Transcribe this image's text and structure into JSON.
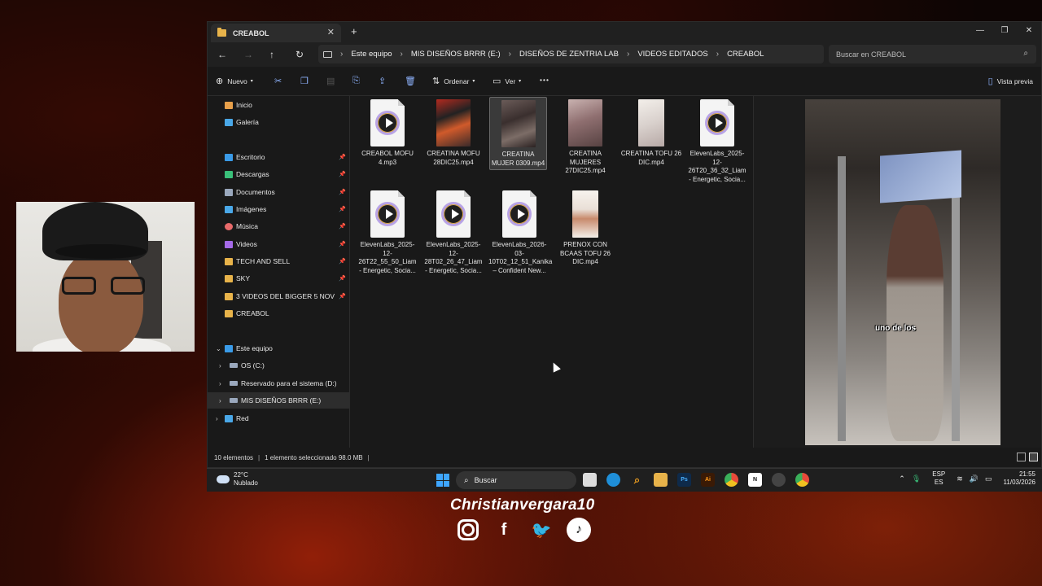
{
  "explorer": {
    "tab_title": "CREABOL",
    "tab_close": "✕",
    "new_tab": "+",
    "window_controls": [
      "—",
      "❐",
      "✕"
    ],
    "breadcrumb": [
      "Este equipo",
      "MIS DISEÑOS BRRR (E:)",
      "DISEÑOS DE ZENTRIA LAB",
      "VIDEOS EDITADOS",
      "CREABOL"
    ],
    "breadcrumb_separator": "›",
    "search_placeholder": "Buscar en CREABOL",
    "toolbar": {
      "new_label": "Nuevo",
      "sort_label": "Ordenar",
      "view_label": "Ver",
      "more_label": "•••",
      "preview_label": "Vista previa"
    },
    "sidebar": {
      "items": [
        {
          "label": "Inicio",
          "icon": "home-icon",
          "color": "#e8a04a"
        },
        {
          "label": "Galería",
          "icon": "gallery-icon",
          "color": "#4aa8e8"
        },
        {
          "label": "Escritorio",
          "icon": "desktop-icon",
          "color": "#3a9be8",
          "pinned": true
        },
        {
          "label": "Descargas",
          "icon": "download-icon",
          "color": "#3ac07a",
          "pinned": true
        },
        {
          "label": "Documentos",
          "icon": "documents-icon",
          "color": "#9aa8bd",
          "pinned": true
        },
        {
          "label": "Imágenes",
          "icon": "pictures-icon",
          "color": "#4aa8e8",
          "pinned": true
        },
        {
          "label": "Música",
          "icon": "music-icon",
          "color": "#e86a6a",
          "pinned": true
        },
        {
          "label": "Videos",
          "icon": "videos-icon",
          "color": "#a56ae8",
          "pinned": true
        },
        {
          "label": "TECH AND SELL",
          "icon": "folder-icon",
          "color": "#e8b34a",
          "pinned": true
        },
        {
          "label": "SKY",
          "icon": "folder-icon",
          "color": "#e8b34a",
          "pinned": true
        },
        {
          "label": "3 VIDEOS DEL BIGGER 5 NOV",
          "icon": "folder-icon",
          "color": "#e8b34a",
          "pinned": true
        },
        {
          "label": "CREABOL",
          "icon": "folder-icon",
          "color": "#e8b34a"
        }
      ],
      "this_pc": "Este equipo",
      "drives": [
        "OS (C:)",
        "Reservado para el sistema (D:)",
        "MIS DISEÑOS BRRR (E:)"
      ],
      "network": "Red"
    },
    "files": [
      {
        "name": "CREABOL MOFU 4.mp3",
        "kind": "audio"
      },
      {
        "name": "CREATINA MOFU 28DIC25.mp4",
        "kind": "video-red"
      },
      {
        "name": "CREATINA MUJER 0309.mp4",
        "kind": "video",
        "selected": true
      },
      {
        "name": "CREATINA MUJERES 27DIC25.mp4",
        "kind": "video-pink"
      },
      {
        "name": "CREATINA TOFU 26 DIC.mp4",
        "kind": "video-white"
      },
      {
        "name": "ElevenLabs_2025-12-26T20_36_32_Liam - Energetic, Socia...",
        "kind": "audio"
      },
      {
        "name": "ElevenLabs_2025-12-26T22_55_50_Liam - Energetic, Socia...",
        "kind": "audio"
      },
      {
        "name": "ElevenLabs_2025-12-28T02_26_47_Liam - Energetic, Socia...",
        "kind": "audio"
      },
      {
        "name": "ElevenLabs_2026-03-10T02_12_51_Kanika – Confident New...",
        "kind": "audio"
      },
      {
        "name": "PRENOX CON BCAAS TOFU 26 DIC.mp4",
        "kind": "video-food"
      }
    ],
    "preview_caption": "uno de los",
    "status": {
      "count": "10 elementos",
      "selection": "1 elemento seleccionado  98.0 MB"
    }
  },
  "taskbar": {
    "temperature": "22°C",
    "weather": "Nublado",
    "search_label": "Buscar",
    "language": "ESP",
    "region": "ES",
    "time": "21:55",
    "date": "11/03/2026"
  },
  "overlay": {
    "handle": "Christianvergara10"
  }
}
